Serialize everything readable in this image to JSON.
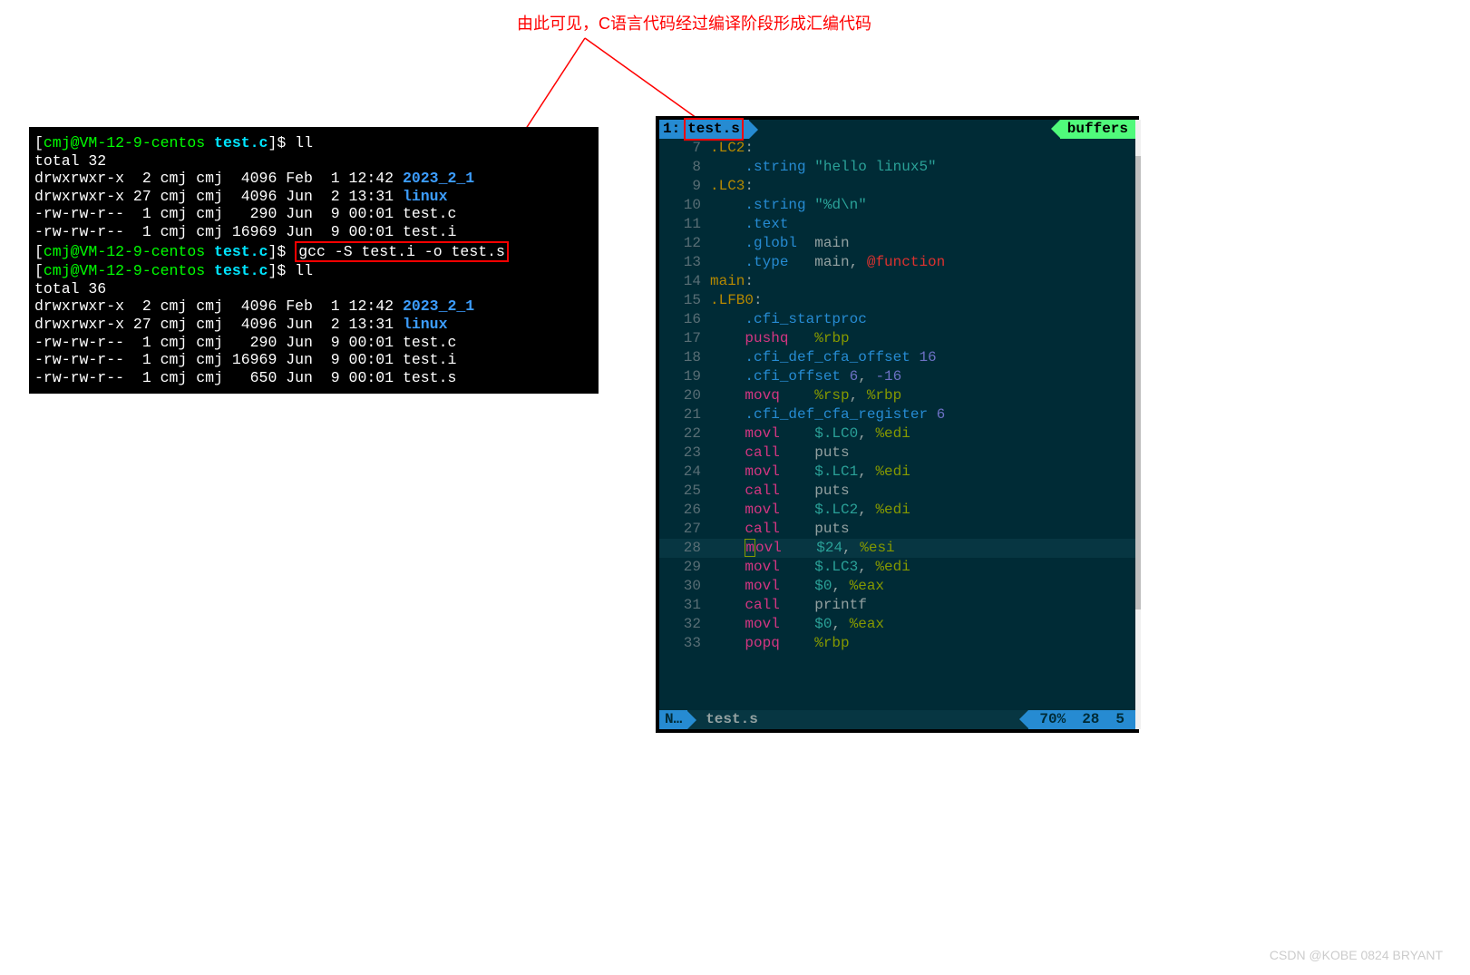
{
  "annotation": "由此可见，C语言代码经过编译阶段形成汇编代码",
  "terminal": {
    "prompt_user": "cmj@VM-12-9-centos",
    "prompt_dir": "test.c",
    "lines": [
      {
        "type": "prompt",
        "cmd": "ll"
      },
      {
        "type": "text",
        "content": "total 32"
      },
      {
        "type": "ls",
        "perm": "drwxrwxr-x",
        "n": "2",
        "owner": "cmj",
        "grp": "cmj",
        "size": "4096",
        "date": "Feb  1 12:42",
        "name": "2023_2_1",
        "cls": "term-blue"
      },
      {
        "type": "ls",
        "perm": "drwxrwxr-x",
        "n": "27",
        "owner": "cmj",
        "grp": "cmj",
        "size": "4096",
        "date": "Jun  2 13:31",
        "name": "linux",
        "cls": "term-blue"
      },
      {
        "type": "ls",
        "perm": "-rw-rw-r--",
        "n": "1",
        "owner": "cmj",
        "grp": "cmj",
        "size": "290",
        "date": "Jun  9 00:01",
        "name": "test.c",
        "cls": ""
      },
      {
        "type": "ls",
        "perm": "-rw-rw-r--",
        "n": "1",
        "owner": "cmj",
        "grp": "cmj",
        "size": "16969",
        "date": "Jun  9 00:01",
        "name": "test.i",
        "cls": ""
      },
      {
        "type": "prompt",
        "cmd": "gcc -S test.i -o test.s",
        "boxed": true
      },
      {
        "type": "prompt",
        "cmd": "ll"
      },
      {
        "type": "text",
        "content": "total 36"
      },
      {
        "type": "ls",
        "perm": "drwxrwxr-x",
        "n": "2",
        "owner": "cmj",
        "grp": "cmj",
        "size": "4096",
        "date": "Feb  1 12:42",
        "name": "2023_2_1",
        "cls": "term-blue"
      },
      {
        "type": "ls",
        "perm": "drwxrwxr-x",
        "n": "27",
        "owner": "cmj",
        "grp": "cmj",
        "size": "4096",
        "date": "Jun  2 13:31",
        "name": "linux",
        "cls": "term-blue"
      },
      {
        "type": "ls",
        "perm": "-rw-rw-r--",
        "n": "1",
        "owner": "cmj",
        "grp": "cmj",
        "size": "290",
        "date": "Jun  9 00:01",
        "name": "test.c",
        "cls": ""
      },
      {
        "type": "ls",
        "perm": "-rw-rw-r--",
        "n": "1",
        "owner": "cmj",
        "grp": "cmj",
        "size": "16969",
        "date": "Jun  9 00:01",
        "name": "test.i",
        "cls": ""
      },
      {
        "type": "ls",
        "perm": "-rw-rw-r--",
        "n": "1",
        "owner": "cmj",
        "grp": "cmj",
        "size": "650",
        "date": "Jun  9 00:01",
        "name": "test.s",
        "cls": ""
      }
    ]
  },
  "editor": {
    "tab_index": "1:",
    "tab_file": "test.s",
    "buffers_label": "buffers",
    "mode": "N…",
    "status_file": "test.s",
    "percent": "70%",
    "line": "28",
    "col": "5",
    "code": [
      {
        "n": 7,
        "hl": false,
        "segs": [
          {
            "t": ".LC2",
            "c": "c-yellow"
          },
          {
            "t": ":",
            "c": "c-base"
          }
        ]
      },
      {
        "n": 8,
        "hl": false,
        "segs": [
          {
            "t": "    ",
            "c": ""
          },
          {
            "t": ".string",
            "c": "c-blue"
          },
          {
            "t": " ",
            "c": ""
          },
          {
            "t": "\"hello linux5\"",
            "c": "c-cyan"
          }
        ]
      },
      {
        "n": 9,
        "hl": false,
        "segs": [
          {
            "t": ".LC3",
            "c": "c-yellow"
          },
          {
            "t": ":",
            "c": "c-base"
          }
        ]
      },
      {
        "n": 10,
        "hl": false,
        "segs": [
          {
            "t": "    ",
            "c": ""
          },
          {
            "t": ".string",
            "c": "c-blue"
          },
          {
            "t": " ",
            "c": ""
          },
          {
            "t": "\"%d\\n\"",
            "c": "c-cyan"
          }
        ]
      },
      {
        "n": 11,
        "hl": false,
        "segs": [
          {
            "t": "    ",
            "c": ""
          },
          {
            "t": ".text",
            "c": "c-blue"
          }
        ]
      },
      {
        "n": 12,
        "hl": false,
        "segs": [
          {
            "t": "    ",
            "c": ""
          },
          {
            "t": ".globl",
            "c": "c-blue"
          },
          {
            "t": "  main",
            "c": "c-base"
          }
        ]
      },
      {
        "n": 13,
        "hl": false,
        "segs": [
          {
            "t": "    ",
            "c": ""
          },
          {
            "t": ".type",
            "c": "c-blue"
          },
          {
            "t": "   main, ",
            "c": "c-base"
          },
          {
            "t": "@function",
            "c": "c-red"
          }
        ]
      },
      {
        "n": 14,
        "hl": false,
        "segs": [
          {
            "t": "main",
            "c": "c-yellow"
          },
          {
            "t": ":",
            "c": "c-base"
          }
        ]
      },
      {
        "n": 15,
        "hl": false,
        "segs": [
          {
            "t": ".LFB0",
            "c": "c-yellow"
          },
          {
            "t": ":",
            "c": "c-base"
          }
        ]
      },
      {
        "n": 16,
        "hl": false,
        "segs": [
          {
            "t": "    ",
            "c": ""
          },
          {
            "t": ".cfi_startproc",
            "c": "c-blue"
          }
        ]
      },
      {
        "n": 17,
        "hl": false,
        "segs": [
          {
            "t": "    ",
            "c": ""
          },
          {
            "t": "pushq",
            "c": "c-pink"
          },
          {
            "t": "   ",
            "c": ""
          },
          {
            "t": "%rbp",
            "c": "c-green"
          }
        ]
      },
      {
        "n": 18,
        "hl": false,
        "segs": [
          {
            "t": "    ",
            "c": ""
          },
          {
            "t": ".cfi_def_cfa_offset",
            "c": "c-blue"
          },
          {
            "t": " ",
            "c": ""
          },
          {
            "t": "16",
            "c": "c-violet"
          }
        ]
      },
      {
        "n": 19,
        "hl": false,
        "segs": [
          {
            "t": "    ",
            "c": ""
          },
          {
            "t": ".cfi_offset",
            "c": "c-blue"
          },
          {
            "t": " ",
            "c": ""
          },
          {
            "t": "6",
            "c": "c-violet"
          },
          {
            "t": ", ",
            "c": "c-base"
          },
          {
            "t": "-16",
            "c": "c-violet"
          }
        ]
      },
      {
        "n": 20,
        "hl": false,
        "segs": [
          {
            "t": "    ",
            "c": ""
          },
          {
            "t": "movq",
            "c": "c-pink"
          },
          {
            "t": "    ",
            "c": ""
          },
          {
            "t": "%rsp",
            "c": "c-green"
          },
          {
            "t": ", ",
            "c": "c-base"
          },
          {
            "t": "%rbp",
            "c": "c-green"
          }
        ]
      },
      {
        "n": 21,
        "hl": false,
        "segs": [
          {
            "t": "    ",
            "c": ""
          },
          {
            "t": ".cfi_def_cfa_register",
            "c": "c-blue"
          },
          {
            "t": " ",
            "c": ""
          },
          {
            "t": "6",
            "c": "c-violet"
          }
        ]
      },
      {
        "n": 22,
        "hl": false,
        "segs": [
          {
            "t": "    ",
            "c": ""
          },
          {
            "t": "movl",
            "c": "c-pink"
          },
          {
            "t": "    ",
            "c": ""
          },
          {
            "t": "$.LC0",
            "c": "c-cyan"
          },
          {
            "t": ", ",
            "c": "c-base"
          },
          {
            "t": "%edi",
            "c": "c-green"
          }
        ]
      },
      {
        "n": 23,
        "hl": false,
        "segs": [
          {
            "t": "    ",
            "c": ""
          },
          {
            "t": "call",
            "c": "c-pink"
          },
          {
            "t": "    puts",
            "c": "c-base"
          }
        ]
      },
      {
        "n": 24,
        "hl": false,
        "segs": [
          {
            "t": "    ",
            "c": ""
          },
          {
            "t": "movl",
            "c": "c-pink"
          },
          {
            "t": "    ",
            "c": ""
          },
          {
            "t": "$.LC1",
            "c": "c-cyan"
          },
          {
            "t": ", ",
            "c": "c-base"
          },
          {
            "t": "%edi",
            "c": "c-green"
          }
        ]
      },
      {
        "n": 25,
        "hl": false,
        "segs": [
          {
            "t": "    ",
            "c": ""
          },
          {
            "t": "call",
            "c": "c-pink"
          },
          {
            "t": "    puts",
            "c": "c-base"
          }
        ]
      },
      {
        "n": 26,
        "hl": false,
        "segs": [
          {
            "t": "    ",
            "c": ""
          },
          {
            "t": "movl",
            "c": "c-pink"
          },
          {
            "t": "    ",
            "c": ""
          },
          {
            "t": "$.LC2",
            "c": "c-cyan"
          },
          {
            "t": ", ",
            "c": "c-base"
          },
          {
            "t": "%edi",
            "c": "c-green"
          }
        ]
      },
      {
        "n": 27,
        "hl": false,
        "segs": [
          {
            "t": "    ",
            "c": ""
          },
          {
            "t": "call",
            "c": "c-pink"
          },
          {
            "t": "    puts",
            "c": "c-base"
          }
        ]
      },
      {
        "n": 28,
        "hl": true,
        "segs": [
          {
            "t": "    ",
            "c": ""
          },
          {
            "t": "m",
            "c": "c-pink",
            "cursor": true
          },
          {
            "t": "ovl",
            "c": "c-pink"
          },
          {
            "t": "    ",
            "c": ""
          },
          {
            "t": "$24",
            "c": "c-cyan"
          },
          {
            "t": ", ",
            "c": "c-base"
          },
          {
            "t": "%esi",
            "c": "c-green"
          }
        ]
      },
      {
        "n": 29,
        "hl": false,
        "segs": [
          {
            "t": "    ",
            "c": ""
          },
          {
            "t": "movl",
            "c": "c-pink"
          },
          {
            "t": "    ",
            "c": ""
          },
          {
            "t": "$.LC3",
            "c": "c-cyan"
          },
          {
            "t": ", ",
            "c": "c-base"
          },
          {
            "t": "%edi",
            "c": "c-green"
          }
        ]
      },
      {
        "n": 30,
        "hl": false,
        "segs": [
          {
            "t": "    ",
            "c": ""
          },
          {
            "t": "movl",
            "c": "c-pink"
          },
          {
            "t": "    ",
            "c": ""
          },
          {
            "t": "$0",
            "c": "c-cyan"
          },
          {
            "t": ", ",
            "c": "c-base"
          },
          {
            "t": "%eax",
            "c": "c-green"
          }
        ]
      },
      {
        "n": 31,
        "hl": false,
        "segs": [
          {
            "t": "    ",
            "c": ""
          },
          {
            "t": "call",
            "c": "c-pink"
          },
          {
            "t": "    printf",
            "c": "c-base"
          }
        ]
      },
      {
        "n": 32,
        "hl": false,
        "segs": [
          {
            "t": "    ",
            "c": ""
          },
          {
            "t": "movl",
            "c": "c-pink"
          },
          {
            "t": "    ",
            "c": ""
          },
          {
            "t": "$0",
            "c": "c-cyan"
          },
          {
            "t": ", ",
            "c": "c-base"
          },
          {
            "t": "%eax",
            "c": "c-green"
          }
        ]
      },
      {
        "n": 33,
        "hl": false,
        "segs": [
          {
            "t": "    ",
            "c": ""
          },
          {
            "t": "popq",
            "c": "c-pink"
          },
          {
            "t": "    ",
            "c": ""
          },
          {
            "t": "%rbp",
            "c": "c-green"
          }
        ]
      }
    ]
  },
  "watermark": "CSDN @KOBE 0824 BRYANT"
}
